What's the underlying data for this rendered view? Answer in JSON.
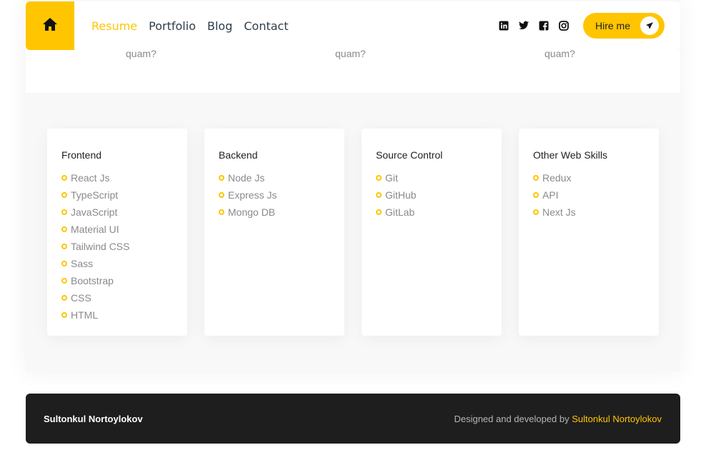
{
  "header": {
    "home_icon": "home-icon",
    "nav": [
      {
        "label": "Resume",
        "active": true
      },
      {
        "label": "Portfolio",
        "active": false
      },
      {
        "label": "Blog",
        "active": false
      },
      {
        "label": "Contact",
        "active": false
      }
    ],
    "socials": [
      "linkedin-icon",
      "twitter-icon",
      "facebook-icon",
      "instagram-icon"
    ],
    "hire_label": "Hire me",
    "hire_icon": "send-icon"
  },
  "testimonials_tail": [
    "quam?",
    "quam?",
    "quam?"
  ],
  "skills": [
    {
      "title": "Frontend",
      "items": [
        "React Js",
        "TypeScript",
        "JavaScript",
        "Material UI",
        "Tailwind CSS",
        "Sass",
        "Bootstrap",
        "CSS",
        "HTML"
      ]
    },
    {
      "title": "Backend",
      "items": [
        "Node Js",
        "Express Js",
        "Mongo DB"
      ]
    },
    {
      "title": "Source Control",
      "items": [
        "Git",
        "GitHub",
        "GitLab"
      ]
    },
    {
      "title": "Other Web Skills",
      "items": [
        "Redux",
        "API",
        "Next Js"
      ]
    }
  ],
  "footer": {
    "name": "Sultonkul Nortoylokov",
    "credit_prefix": "Designed and developed by",
    "credit_author": "Sultonkul Nortoylokov"
  },
  "colors": {
    "accent": "#ffc500",
    "footer_bg": "#1e1e1e",
    "nav_text": "#2f3e4a"
  }
}
